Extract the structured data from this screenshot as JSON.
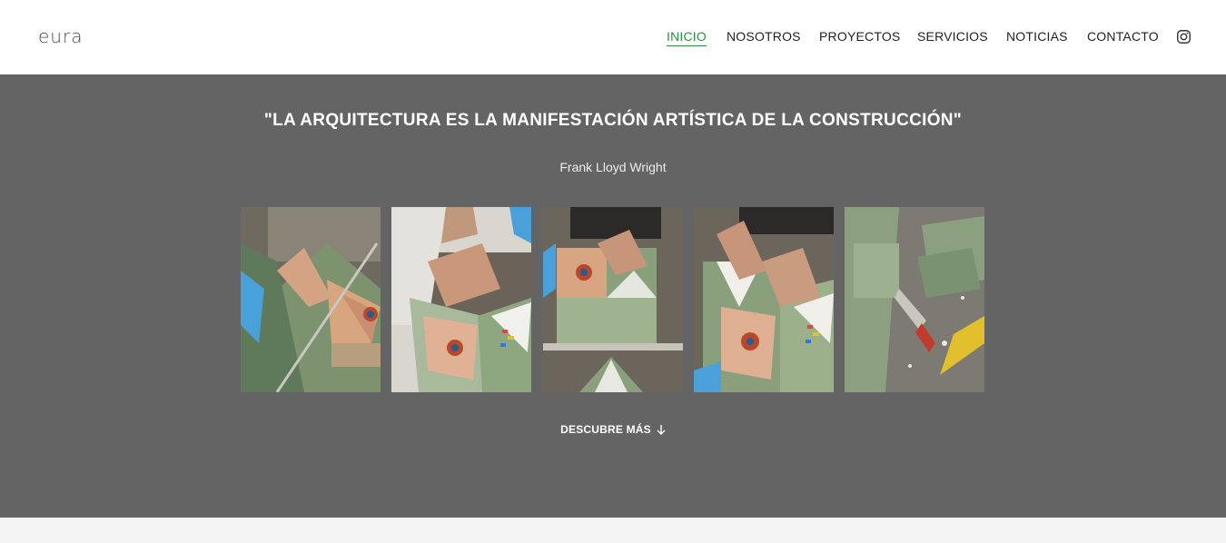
{
  "brand": {
    "logo_text": "eura"
  },
  "nav": {
    "items": [
      {
        "label": "INICIO",
        "active": true
      },
      {
        "label": "NOSOTROS",
        "active": false
      },
      {
        "label": "PROYECTOS",
        "active": false
      },
      {
        "label": "SERVICIOS",
        "active": false
      },
      {
        "label": "NOTICIAS",
        "active": false
      },
      {
        "label": "CONTACTO",
        "active": false
      }
    ],
    "social_icon": "instagram-icon"
  },
  "hero": {
    "quote": "\"LA ARQUITECTURA ES LA MANIFESTACIÓN ARTÍSTICA DE LA CONSTRUCCIÓN\"",
    "author": "Frank Lloyd Wright",
    "cta_label": "DESCUBRE MÁS",
    "cta_icon": "arrow-down-icon"
  },
  "gallery": {
    "photo_count": 5
  },
  "colors": {
    "accent": "#2f8a45",
    "hero_bg": "#646464",
    "header_bg": "#ffffff",
    "footer_band": "#f4f4f4"
  }
}
